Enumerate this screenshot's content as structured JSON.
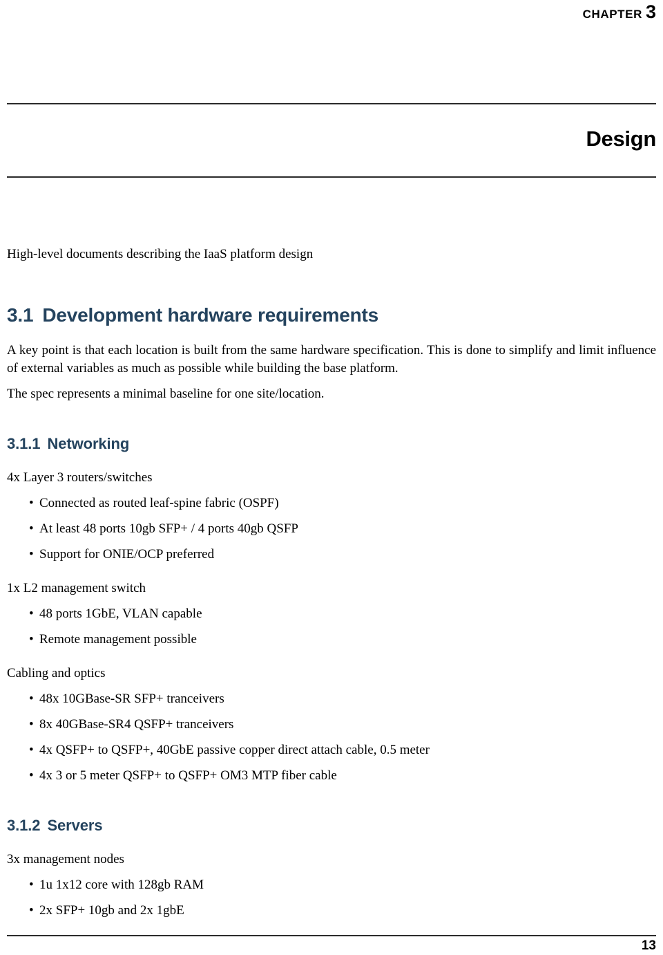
{
  "header": {
    "chapter_word": "CHAPTER",
    "chapter_number": "3"
  },
  "title": {
    "text": "Design"
  },
  "intro": {
    "text": "High-level documents describing the IaaS platform design"
  },
  "section": {
    "number": "3.1",
    "title": "Development hardware requirements",
    "paragraphs": [
      "A key point is that each location is built from the same hardware specification.  This is done to simplify and limit influence of external variables as much as possible while building the base platform.",
      "The spec represents a minimal baseline for one site/location."
    ]
  },
  "subsections": [
    {
      "number": "3.1.1",
      "title": "Networking",
      "groups": [
        {
          "heading": "4x Layer 3 routers/switches",
          "items": [
            "Connected as routed leaf-spine fabric (OSPF)",
            "At least 48 ports 10gb SFP+ / 4 ports 40gb QSFP",
            "Support for ONIE/OCP preferred"
          ]
        },
        {
          "heading": "1x L2 management switch",
          "items": [
            "48 ports 1GbE, VLAN capable",
            "Remote management possible"
          ]
        },
        {
          "heading": "Cabling and optics",
          "items": [
            "48x 10GBase-SR SFP+ tranceivers",
            "8x 40GBase-SR4 QSFP+ tranceivers",
            "4x QSFP+ to QSFP+, 40GbE passive copper direct attach cable, 0.5 meter",
            "4x 3 or 5 meter QSFP+ to QSFP+ OM3 MTP fiber cable"
          ]
        }
      ]
    },
    {
      "number": "3.1.2",
      "title": "Servers",
      "groups": [
        {
          "heading": "3x management nodes",
          "items": [
            "1u 1x12 core with 128gb RAM",
            "2x SFP+ 10gb and 2x 1gbE"
          ]
        }
      ]
    }
  ],
  "bullet_glyph": "•",
  "footer": {
    "page_number": "13"
  },
  "colors": {
    "heading": "#24435E",
    "rule": "#2b2b2b",
    "text": "#000000"
  }
}
